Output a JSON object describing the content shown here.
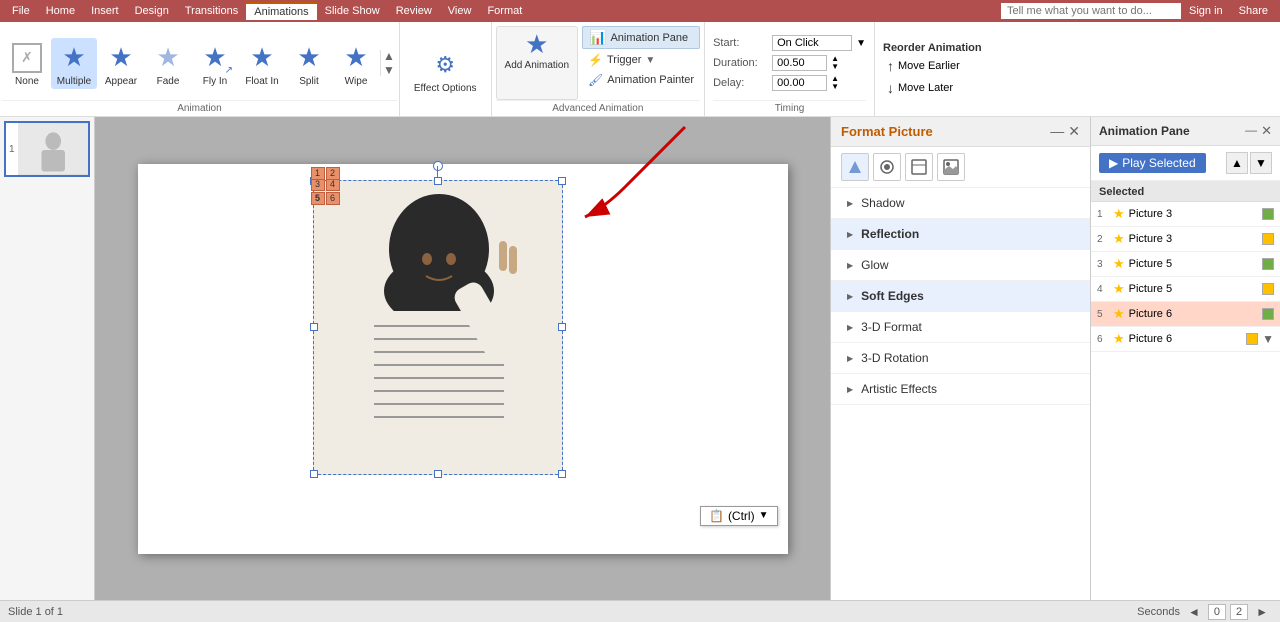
{
  "ribbon": {
    "tabs": [
      "File",
      "Home",
      "Insert",
      "Design",
      "Transitions",
      "Animations",
      "Slide Show",
      "Review",
      "View",
      "Format"
    ],
    "active_tab": "Animations",
    "search_placeholder": "Tell me what you want to do...",
    "sign_in": "Sign in",
    "share": "Share"
  },
  "animations": {
    "items": [
      {
        "id": "none",
        "label": "None",
        "icon": "○",
        "active": false
      },
      {
        "id": "multiple",
        "label": "Multiple",
        "icon": "★",
        "active": true
      },
      {
        "id": "appear",
        "label": "Appear",
        "icon": "★",
        "active": false
      },
      {
        "id": "fade",
        "label": "Fade",
        "icon": "★",
        "active": false
      },
      {
        "id": "fly_in",
        "label": "Fly In",
        "icon": "★",
        "active": false
      },
      {
        "id": "float_in",
        "label": "Float In",
        "icon": "★",
        "active": false
      },
      {
        "id": "split",
        "label": "Split",
        "icon": "★",
        "active": false
      },
      {
        "id": "wipe",
        "label": "Wipe",
        "icon": "★",
        "active": false
      }
    ],
    "group_label": "Animation"
  },
  "add_animation": {
    "label": "Add Animation",
    "icon": "★"
  },
  "animation_pane_btn": "Animation Pane",
  "trigger_btn": "Trigger",
  "animation_painter_btn": "Animation Painter",
  "effect_options": "Effect Options",
  "advanced_animation_label": "Advanced Animation",
  "timing": {
    "start_label": "Start:",
    "start_value": "On Click",
    "duration_label": "Duration:",
    "duration_value": "00.50",
    "delay_label": "Delay:",
    "delay_value": "00.00",
    "label": "Timing"
  },
  "reorder": {
    "label": "Reorder Animation",
    "move_earlier": "Move Earlier",
    "move_later": "Move Later"
  },
  "format_picture": {
    "title": "Format Picture",
    "items": [
      {
        "label": "Shadow",
        "expanded": false
      },
      {
        "label": "Reflection",
        "expanded": false
      },
      {
        "label": "Glow",
        "expanded": false
      },
      {
        "label": "Soft Edges",
        "expanded": false
      },
      {
        "label": "3-D Format",
        "expanded": false
      },
      {
        "label": "3-D Rotation",
        "expanded": false
      },
      {
        "label": "Artistic Effects",
        "expanded": false
      }
    ]
  },
  "animation_pane": {
    "title": "Animation Pane",
    "play_selected": "Play Selected",
    "items": [
      {
        "num": 1,
        "name": "Picture 3",
        "color": "#70ad47",
        "selected": false
      },
      {
        "num": 2,
        "name": "Picture 3",
        "color": "#ffc000",
        "selected": false
      },
      {
        "num": 3,
        "name": "Picture 5",
        "color": "#70ad47",
        "selected": false
      },
      {
        "num": 4,
        "name": "Picture 5",
        "color": "#ffc000",
        "selected": false
      },
      {
        "num": 5,
        "name": "Picture 6",
        "color": "#70ad47",
        "selected": true
      },
      {
        "num": 6,
        "name": "Picture 6",
        "color": "#ffc000",
        "selected": false,
        "has_arrow": true
      }
    ]
  },
  "slide_panel": {
    "slide_num": 1
  },
  "ctrl_popup": "(Ctrl)",
  "bottom": {
    "seconds_label": "Seconds",
    "page_prev": "◄",
    "page_0": "0",
    "page_2": "2",
    "page_next": "►"
  }
}
